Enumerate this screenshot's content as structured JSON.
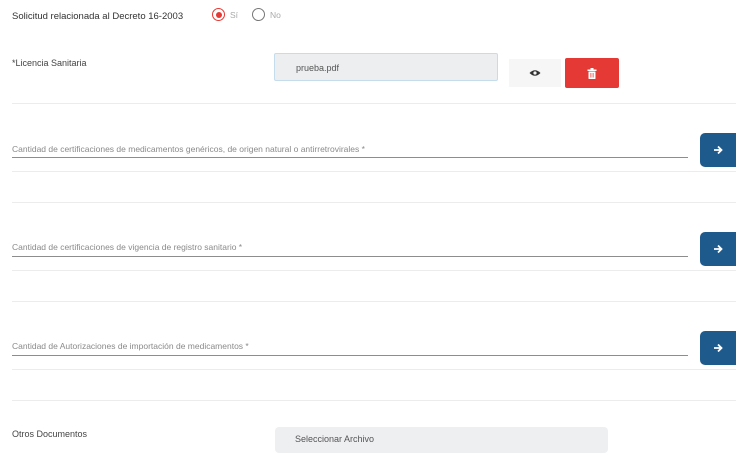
{
  "decree": {
    "question": "Solicitud relacionada al Decreto 16-2003",
    "options": [
      "Sí",
      "No"
    ],
    "selected": "Sí"
  },
  "licencia": {
    "label": "*Licencia Sanitaria",
    "file_name": "prueba.pdf",
    "view_icon": "eye-icon",
    "delete_icon": "trash-icon"
  },
  "fields": [
    {
      "label": "Cantidad de certificaciones de medicamentos genéricos, de origen natural o antirretrovirales *",
      "value": ""
    },
    {
      "label": "Cantidad de certificaciones de vigencia de registro sanitario *",
      "value": ""
    },
    {
      "label": "Cantidad de Autorizaciones de importación de medicamentos *",
      "value": ""
    }
  ],
  "arrow_icon": "arrow-right-icon",
  "otros": {
    "label": "Otros Documentos",
    "button_label": "Seleccionar Archivo"
  },
  "colors": {
    "accent_red": "#e53935",
    "button_blue": "#1e5a8c"
  }
}
